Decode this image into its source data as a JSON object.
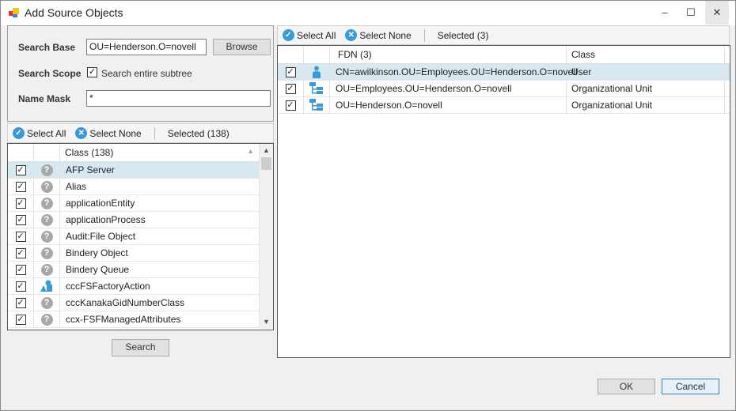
{
  "window": {
    "title": "Add Source Objects",
    "minimize": "‒",
    "maximize": "☐",
    "close": "✕"
  },
  "form": {
    "search_base_label": "Search Base",
    "search_base_value": "OU=Henderson.O=novell",
    "browse": "Browse",
    "search_scope_label": "Search Scope",
    "subtree_label": "Search entire subtree",
    "subtree_checked": true,
    "name_mask_label": "Name Mask",
    "name_mask_value": "*"
  },
  "left_toolbar": {
    "select_all": "Select All",
    "select_none": "Select None",
    "selected": "Selected (138)"
  },
  "left_list": {
    "header": "Class  (138)",
    "rows": [
      {
        "name": "AFP Server",
        "icon": "unknown"
      },
      {
        "name": "Alias",
        "icon": "unknown"
      },
      {
        "name": "applicationEntity",
        "icon": "unknown"
      },
      {
        "name": "applicationProcess",
        "icon": "unknown"
      },
      {
        "name": "Audit:File Object",
        "icon": "unknown"
      },
      {
        "name": "Bindery Object",
        "icon": "unknown"
      },
      {
        "name": "Bindery Queue",
        "icon": "unknown"
      },
      {
        "name": "cccFSFactoryAction",
        "icon": "shapes"
      },
      {
        "name": "cccKanakaGidNumberClass",
        "icon": "unknown"
      },
      {
        "name": "ccx-FSFManagedAttributes",
        "icon": "unknown"
      }
    ]
  },
  "search_button": "Search",
  "right_toolbar": {
    "select_all": "Select All",
    "select_none": "Select None",
    "selected": "Selected (3)"
  },
  "right_list": {
    "headers": [
      "FDN  (3)",
      "Class"
    ],
    "rows": [
      {
        "fdn": "CN=awilkinson.OU=Employees.OU=Henderson.O=novell",
        "class": "User",
        "icon": "user"
      },
      {
        "fdn": "OU=Employees.OU=Henderson.O=novell",
        "class": "Organizational Unit",
        "icon": "org-unit"
      },
      {
        "fdn": "OU=Henderson.O=novell",
        "class": "Organizational Unit",
        "icon": "org-unit"
      }
    ]
  },
  "buttons": {
    "ok": "OK",
    "cancel": "Cancel"
  }
}
